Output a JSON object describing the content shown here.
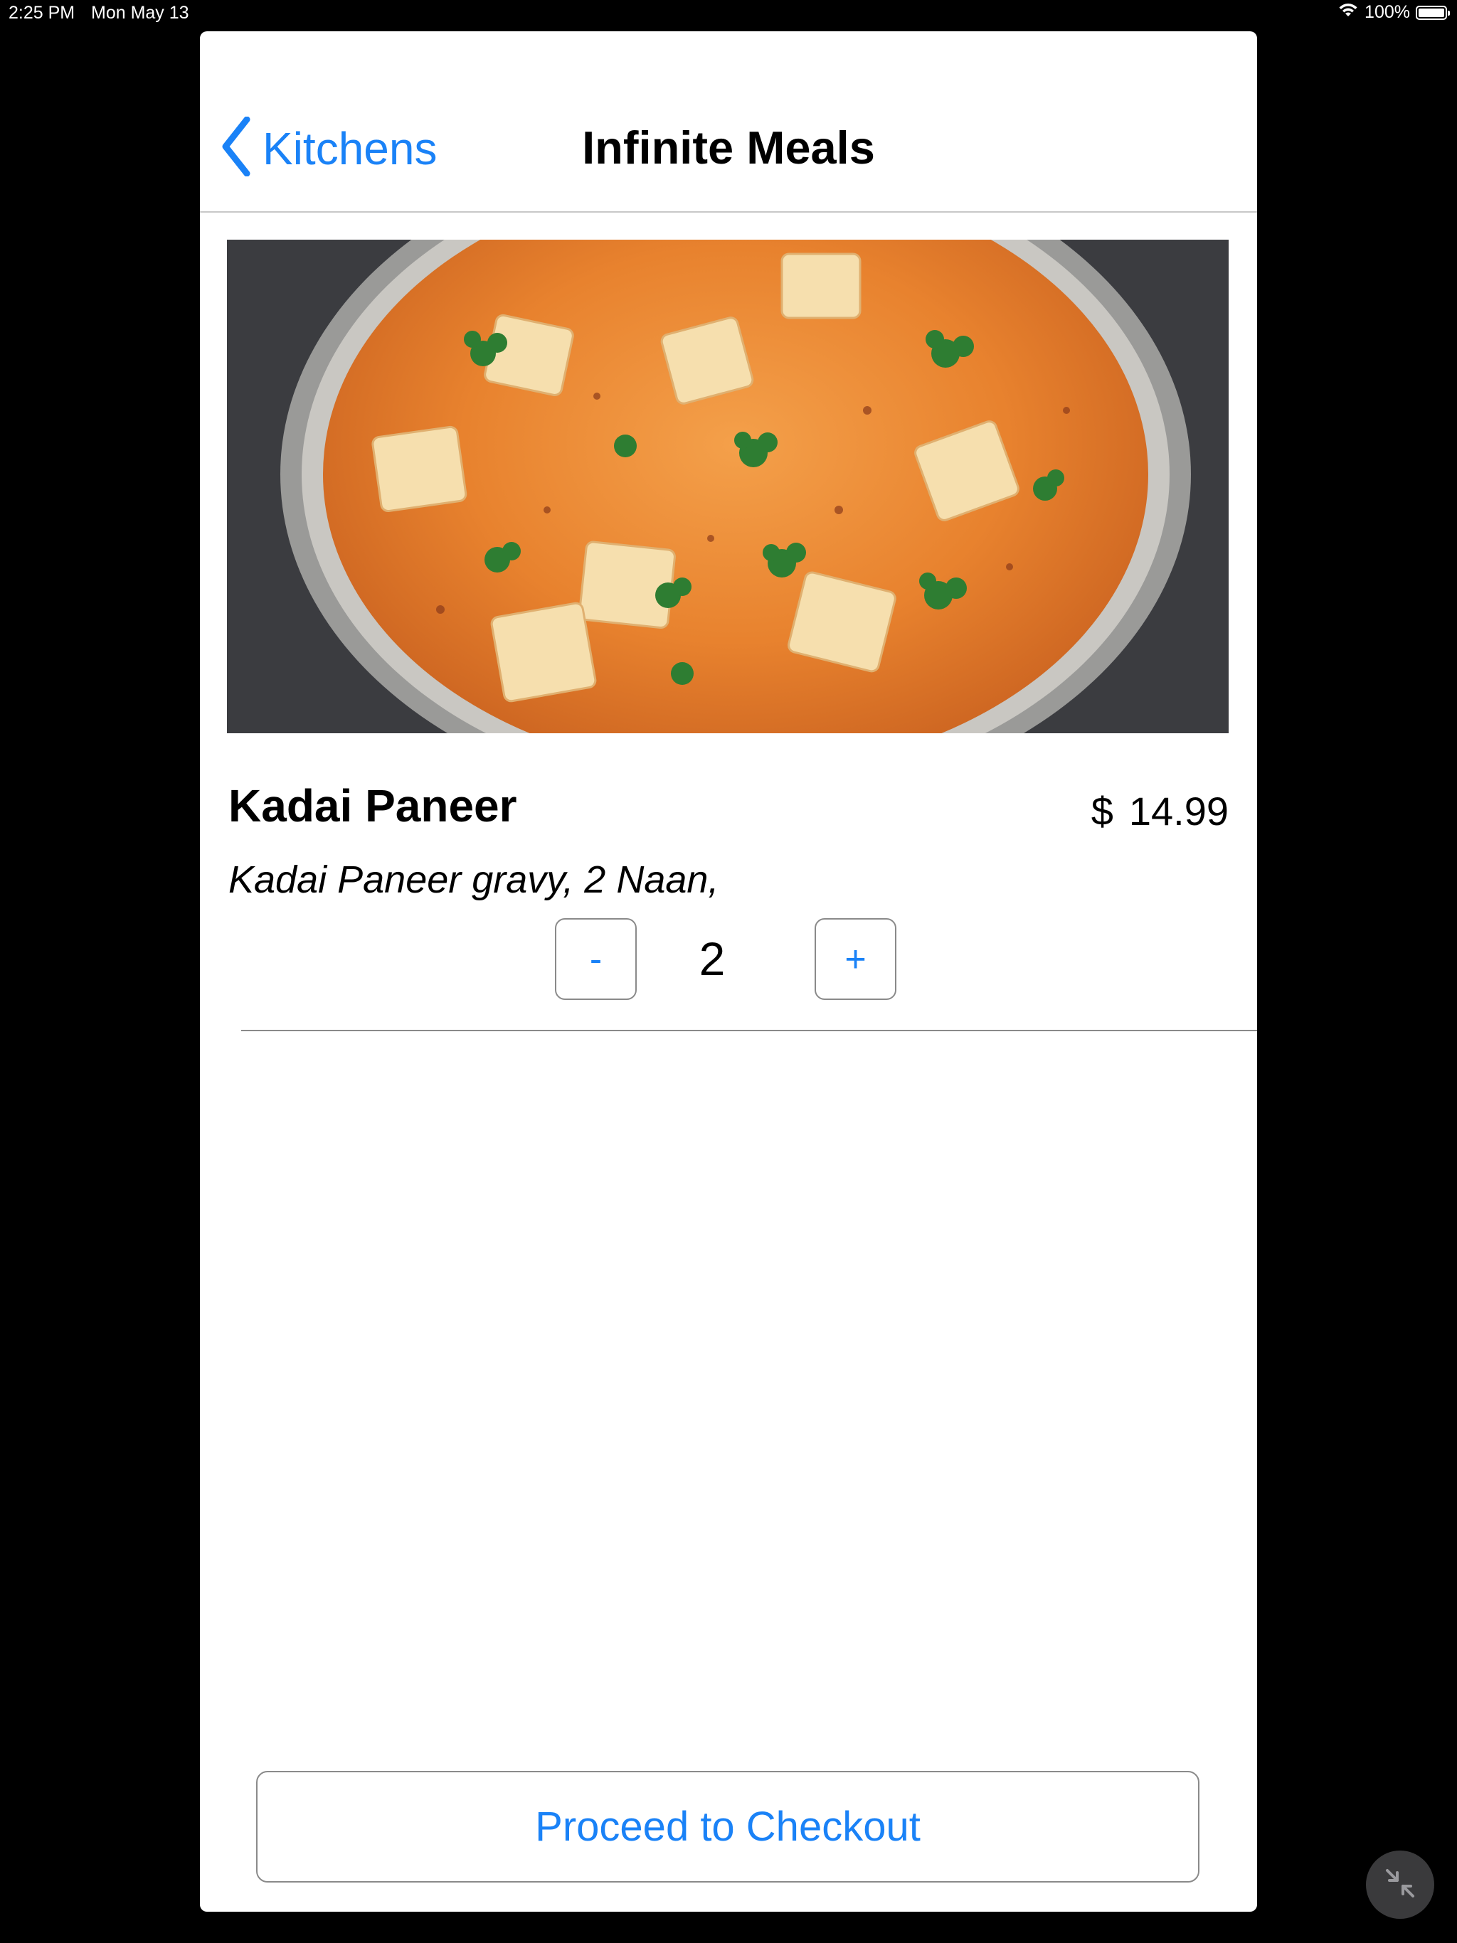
{
  "status_bar": {
    "time": "2:25 PM",
    "date": "Mon May 13",
    "battery_percent": "100%",
    "battery_level": 1.0
  },
  "nav": {
    "back_label": "Kitchens",
    "title": "Infinite Meals"
  },
  "meal": {
    "name": "Kadai Paneer",
    "currency": "$",
    "price": "14.99",
    "description": "Kadai Paneer gravy, 2 Naan,",
    "quantity": "2",
    "minus_label": "-",
    "plus_label": "+"
  },
  "checkout": {
    "label": "Proceed to Checkout"
  },
  "colors": {
    "accent": "#1a82f7",
    "background": "#000000",
    "sheet": "#ffffff"
  },
  "icons": {
    "back": "chevron-left-icon",
    "wifi": "wifi-icon",
    "battery": "battery-icon",
    "collapse": "collapse-arrows-icon"
  }
}
